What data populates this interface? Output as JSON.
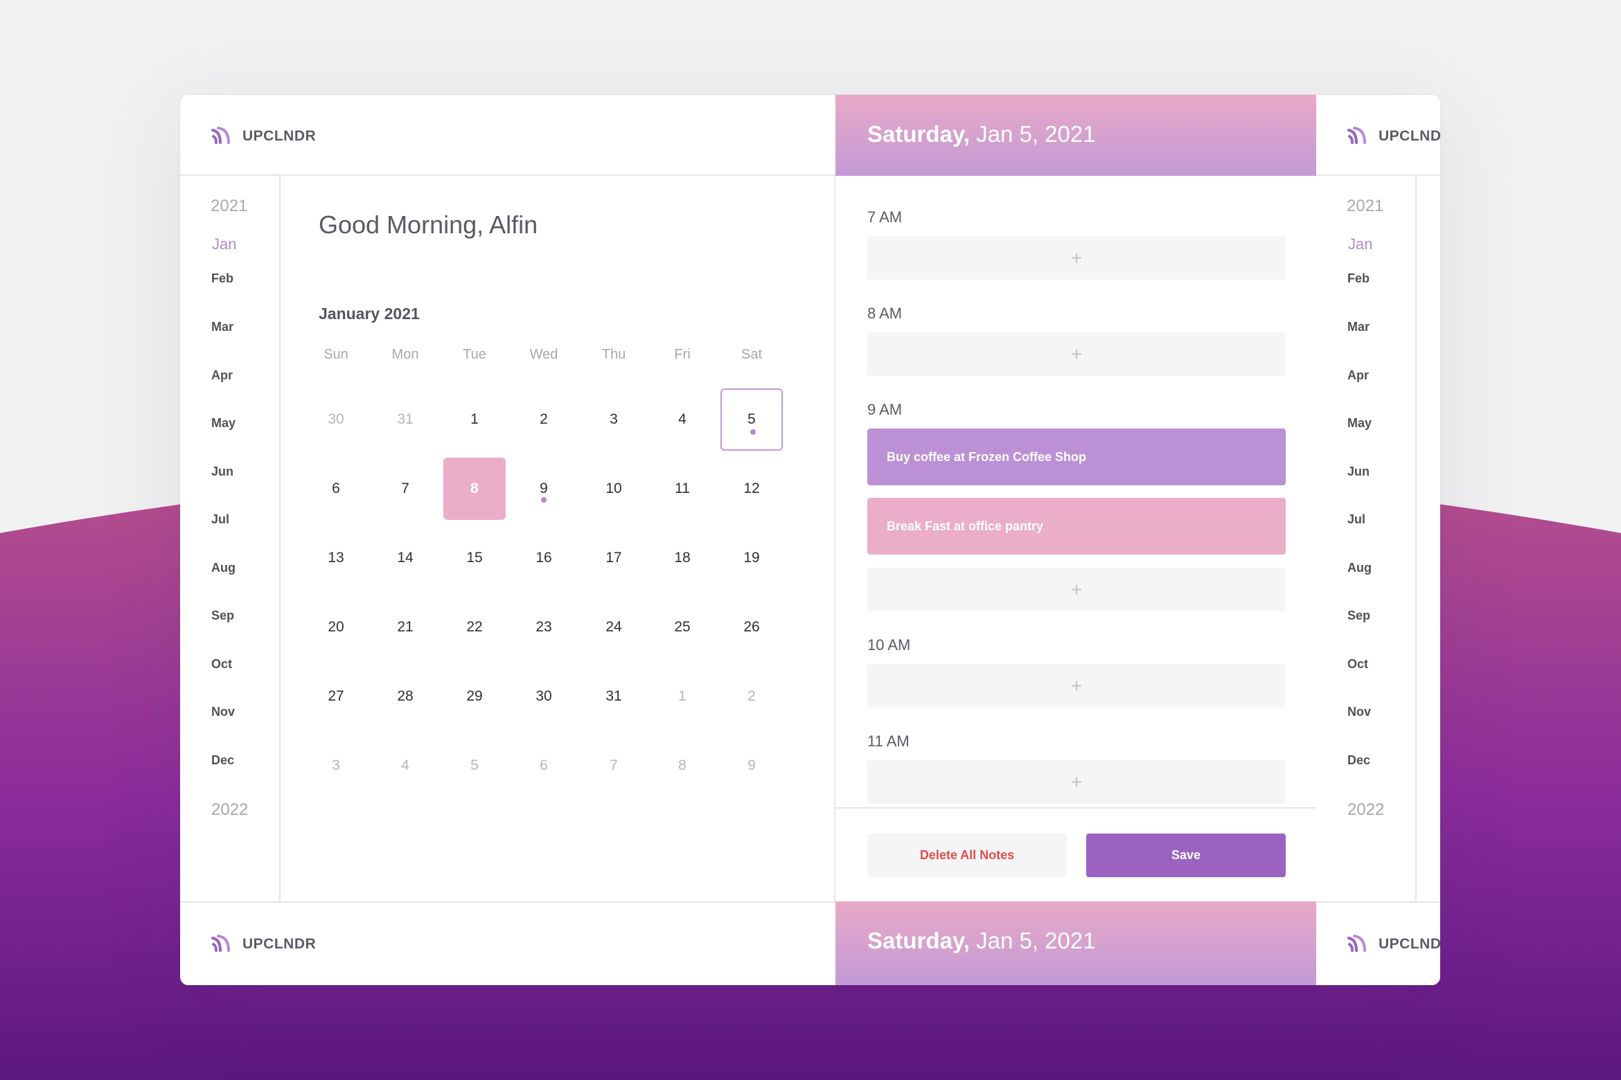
{
  "app": {
    "logo_text": "UPCLNDR",
    "accent_color": "#9b62c1",
    "event_purple": "#bb90d5",
    "event_pink": "#ebaec8",
    "delete_red": "#e24d4d"
  },
  "header": {
    "weekday": "Saturday,",
    "date": "Jan 5, 2021"
  },
  "sidebar": {
    "year_current": "2021",
    "year_next": "2022",
    "months": [
      "Jan",
      "Feb",
      "Mar",
      "Apr",
      "May",
      "Jun",
      "Jul",
      "Aug",
      "Sep",
      "Oct",
      "Nov",
      "Dec"
    ],
    "active_month": "Jan"
  },
  "calendar": {
    "greeting": "Good Morning, Alfin",
    "month_title": "January 2021",
    "weekdays": [
      "Sun",
      "Mon",
      "Tue",
      "Wed",
      "Thu",
      "Fri",
      "Sat"
    ],
    "weeks": [
      [
        "30",
        "31",
        "1",
        "2",
        "3",
        "4",
        "5"
      ],
      [
        "6",
        "7",
        "8",
        "9",
        "10",
        "11",
        "12"
      ],
      [
        "13",
        "14",
        "15",
        "16",
        "17",
        "18",
        "19"
      ],
      [
        "20",
        "21",
        "22",
        "23",
        "24",
        "25",
        "26"
      ],
      [
        "27",
        "28",
        "29",
        "30",
        "31",
        "1",
        "2"
      ],
      [
        "3",
        "4",
        "5",
        "6",
        "7",
        "8",
        "9"
      ]
    ]
  },
  "schedule": {
    "add_symbol": "+",
    "hours": {
      "h7": "7 AM",
      "h8": "8 AM",
      "h9": "9 AM",
      "h10": "10 AM",
      "h11": "11 AM"
    },
    "events": {
      "e1": "Buy coffee at Frozen Coffee Shop",
      "e2": "Break Fast at office pantry"
    }
  },
  "actions": {
    "delete_label": "Delete All Notes",
    "save_label": "Save"
  }
}
